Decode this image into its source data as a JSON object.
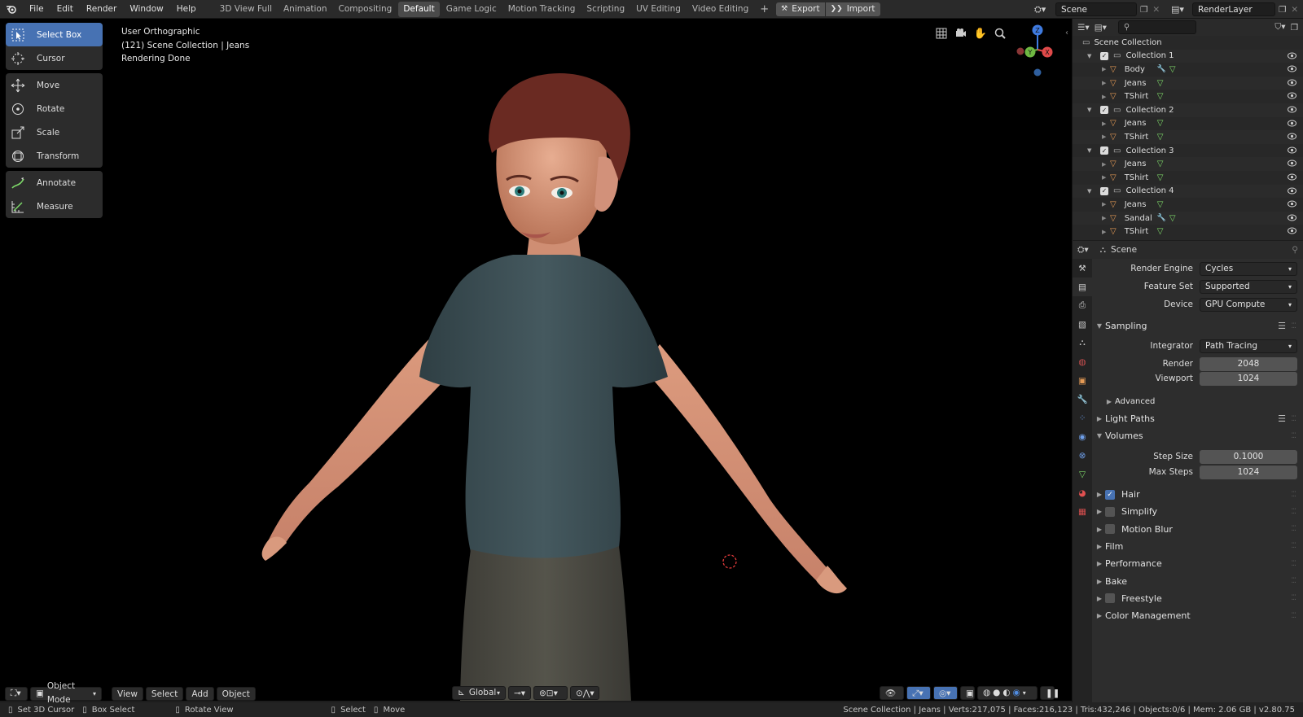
{
  "topbar": {
    "menus": [
      "File",
      "Edit",
      "Render",
      "Window",
      "Help"
    ],
    "workspaces": [
      "3D View Full",
      "Animation",
      "Compositing",
      "Default",
      "Game Logic",
      "Motion Tracking",
      "Scripting",
      "UV Editing",
      "Video Editing"
    ],
    "active_workspace": "Default",
    "add_tab": "+",
    "export_label": "Export",
    "import_label": "Import",
    "scene_name": "Scene",
    "render_layer": "RenderLayer"
  },
  "viewport": {
    "view_name": "User Orthographic",
    "collection_info": "(121) Scene Collection | Jeans",
    "render_status": "Rendering Done"
  },
  "tools": {
    "group1": [
      {
        "label": "Select Box",
        "icon": "select-box-icon",
        "active": true
      },
      {
        "label": "Cursor",
        "icon": "cursor-icon",
        "active": false
      }
    ],
    "group2": [
      {
        "label": "Move",
        "icon": "move-icon"
      },
      {
        "label": "Rotate",
        "icon": "rotate-icon"
      },
      {
        "label": "Scale",
        "icon": "scale-icon"
      },
      {
        "label": "Transform",
        "icon": "transform-icon"
      }
    ],
    "group3": [
      {
        "label": "Annotate",
        "icon": "annotate-icon"
      },
      {
        "label": "Measure",
        "icon": "measure-icon"
      }
    ]
  },
  "gizmo": {
    "z": "Z",
    "y": "Y",
    "x": "X"
  },
  "viewport_footer": {
    "mode": "Object Mode",
    "menus": [
      "View",
      "Select",
      "Add",
      "Object"
    ],
    "orientation": "Global"
  },
  "statusbar": {
    "left_items": [
      "Set 3D Cursor",
      "Box Select",
      "Rotate View",
      "Select",
      "Move"
    ],
    "stats": "Scene Collection | Jeans | Verts:217,075 | Faces:216,123 | Tris:432,246 | Objects:0/6 | Mem: 2.06 GB | v2.80.75"
  },
  "outliner": {
    "root": "Scene Collection",
    "rows": [
      {
        "type": "collection",
        "label": "Collection 1"
      },
      {
        "type": "object",
        "label": "Body",
        "modifier": true
      },
      {
        "type": "object",
        "label": "Jeans",
        "modifier": false
      },
      {
        "type": "object",
        "label": "TShirt",
        "modifier": false
      },
      {
        "type": "collection",
        "label": "Collection 2"
      },
      {
        "type": "object",
        "label": "Jeans",
        "modifier": false
      },
      {
        "type": "object",
        "label": "TShirt",
        "modifier": false
      },
      {
        "type": "collection",
        "label": "Collection 3"
      },
      {
        "type": "object",
        "label": "Jeans",
        "modifier": false
      },
      {
        "type": "object",
        "label": "TShirt",
        "modifier": false
      },
      {
        "type": "collection",
        "label": "Collection 4"
      },
      {
        "type": "object",
        "label": "Jeans",
        "modifier": false
      },
      {
        "type": "object",
        "label": "Sandal",
        "modifier": true
      },
      {
        "type": "object",
        "label": "TShirt",
        "modifier": false
      }
    ]
  },
  "properties": {
    "context": "Scene",
    "render_engine_label": "Render Engine",
    "render_engine": "Cycles",
    "feature_set_label": "Feature Set",
    "feature_set": "Supported",
    "device_label": "Device",
    "device": "GPU Compute",
    "sampling": {
      "title": "Sampling",
      "integrator_label": "Integrator",
      "integrator": "Path Tracing",
      "render_label": "Render",
      "render": "2048",
      "viewport_label": "Viewport",
      "viewport": "1024",
      "advanced": "Advanced"
    },
    "light_paths": "Light Paths",
    "volumes": {
      "title": "Volumes",
      "step_size_label": "Step Size",
      "step_size": "0.1000",
      "max_steps_label": "Max Steps",
      "max_steps": "1024"
    },
    "panels": [
      {
        "label": "Hair",
        "checkbox": true,
        "checked": true
      },
      {
        "label": "Simplify",
        "checkbox": true,
        "checked": false
      },
      {
        "label": "Motion Blur",
        "checkbox": true,
        "checked": false
      },
      {
        "label": "Film",
        "checkbox": false
      },
      {
        "label": "Performance",
        "checkbox": false
      },
      {
        "label": "Bake",
        "checkbox": false
      },
      {
        "label": "Freestyle",
        "checkbox": true,
        "checked": false
      },
      {
        "label": "Color Management",
        "checkbox": false
      }
    ]
  },
  "colors": {
    "accent": "#4772b3",
    "object_icon": "#e49a55",
    "mesh_data": "#7fdc6a",
    "modifier": "#6e9ee8"
  }
}
